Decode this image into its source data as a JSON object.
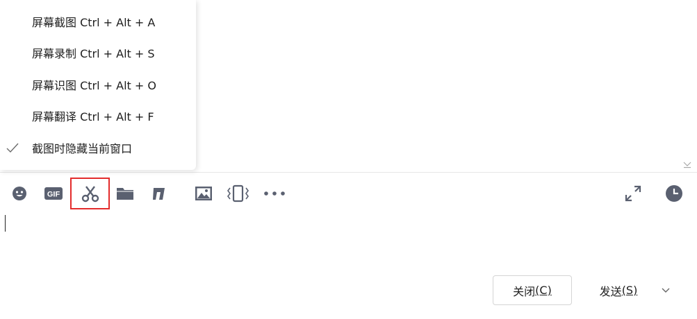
{
  "menu": {
    "items": [
      {
        "label": "屏幕截图 Ctrl + Alt + A",
        "checked": false
      },
      {
        "label": "屏幕录制 Ctrl + Alt + S",
        "checked": false
      },
      {
        "label": "屏幕识图 Ctrl + Alt + O",
        "checked": false
      },
      {
        "label": "屏幕翻译 Ctrl + Alt + F",
        "checked": false
      },
      {
        "label": "截图时隐藏当前窗口",
        "checked": true
      }
    ]
  },
  "toolbar": {
    "left_icons": [
      "emoji-icon",
      "gif-icon",
      "scissors-icon",
      "folder-icon",
      "screen-share-icon",
      "image-icon",
      "shake-icon",
      "more-icon"
    ],
    "right_icons": [
      "expand-icon",
      "history-clock-icon"
    ],
    "highlight_color": "#e32b2b",
    "icon_color": "#5a6070"
  },
  "footer": {
    "close_label": "关闭",
    "close_shortcut": "(C)",
    "send_label": "发送",
    "send_shortcut": "(S)"
  }
}
